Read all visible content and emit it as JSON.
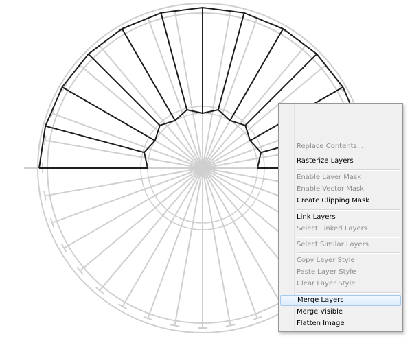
{
  "context_menu": {
    "items": [
      {
        "label": "Replace Contents...",
        "enabled": false
      },
      {
        "label": "Rasterize Layers",
        "enabled": true
      },
      {
        "label": "Enable Layer Mask",
        "enabled": false
      },
      {
        "label": "Enable Vector Mask",
        "enabled": false
      },
      {
        "label": "Create Clipping Mask",
        "enabled": true
      },
      {
        "label": "Link Layers",
        "enabled": true
      },
      {
        "label": "Select Linked Layers",
        "enabled": false
      },
      {
        "label": "Select Similar Layers",
        "enabled": false
      },
      {
        "label": "Copy Layer Style",
        "enabled": false
      },
      {
        "label": "Paste Layer Style",
        "enabled": false
      },
      {
        "label": "Clear Layer Style",
        "enabled": false
      },
      {
        "label": "Merge Layers",
        "enabled": true,
        "highlighted": true
      },
      {
        "label": "Merge Visible",
        "enabled": true
      },
      {
        "label": "Flatten Image",
        "enabled": true
      }
    ]
  },
  "colors": {
    "guide_lines": "#cfcfcf",
    "shape_outline": "#1e1e1e",
    "menu_background": "#f0f0f0",
    "menu_highlight": "#dcebfc",
    "disabled_text": "#8d8d8d"
  }
}
